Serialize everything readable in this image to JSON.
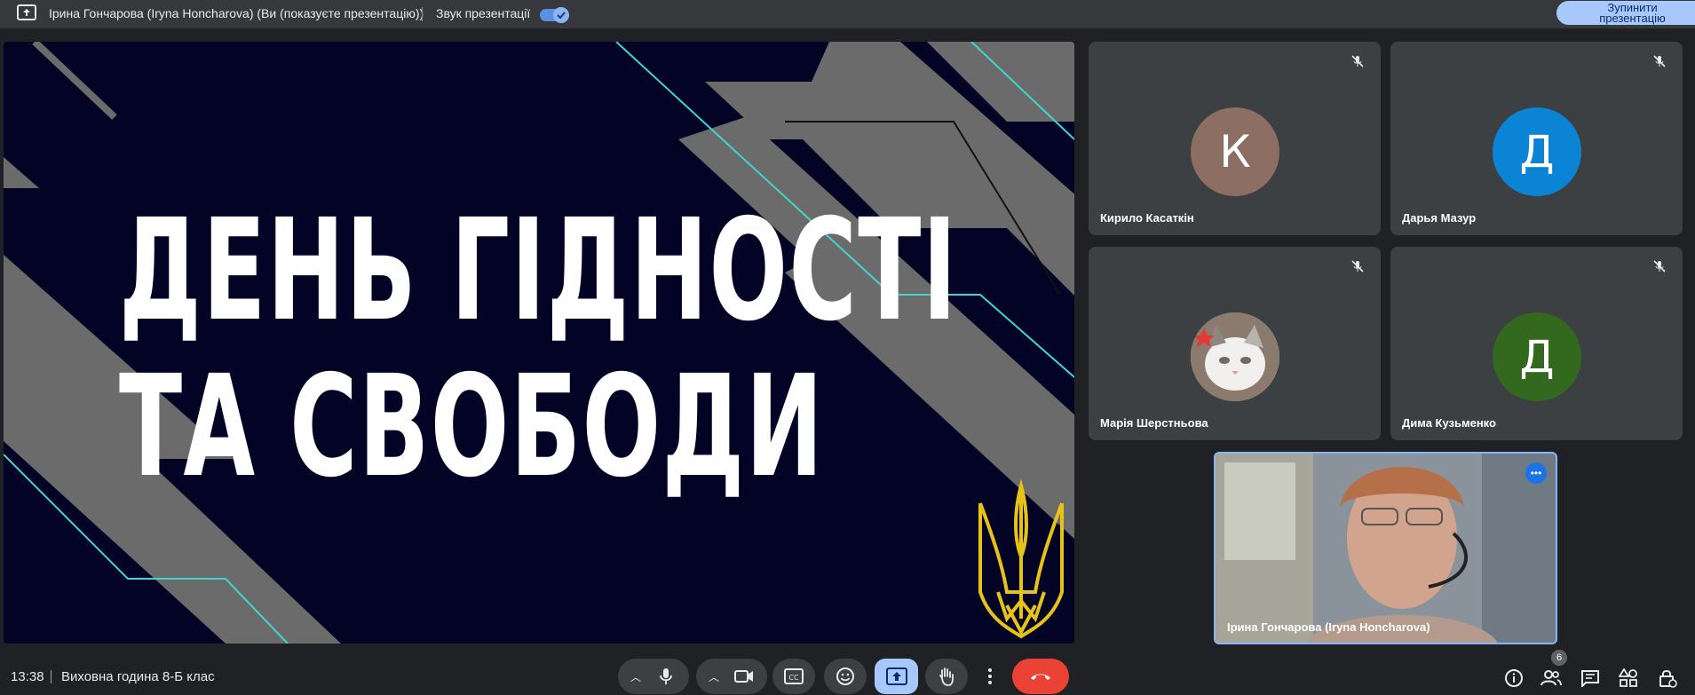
{
  "top_bar": {
    "presenter_text": "Ірина Гончарова (Iryna Honcharova) (Ви (показуєте презентацію))",
    "sound_label": "Звук презентації",
    "sound_enabled": true,
    "stop_button_label": "Зупинити презентацію"
  },
  "slide": {
    "title_line1": "ДЕНЬ ГІДНОСТІ",
    "title_line2": "ТА СВОБОДИ"
  },
  "participants": [
    {
      "name": "Кирило Касаткін",
      "initial": "К",
      "avatar_color": "#8d6e63",
      "muted": true
    },
    {
      "name": "Дарья Мазур",
      "initial": "Д",
      "avatar_color": "#0b84d6",
      "muted": true
    },
    {
      "name": "Марія Шерстньова",
      "initial": "",
      "avatar_type": "cat-photo",
      "muted": true
    },
    {
      "name": "Дима Кузьменко",
      "initial": "Д",
      "avatar_color": "#33691e",
      "muted": true
    }
  ],
  "self_view": {
    "name": "Ірина Гончарова (Iryna Honcharova)"
  },
  "bottom_bar": {
    "time": "13:38",
    "meeting_title": "Виховна година 8-Б клас",
    "people_count": "6"
  },
  "colors": {
    "accent": "#8ab4f8",
    "hangup": "#ea4335",
    "slide_background": "#020325"
  }
}
